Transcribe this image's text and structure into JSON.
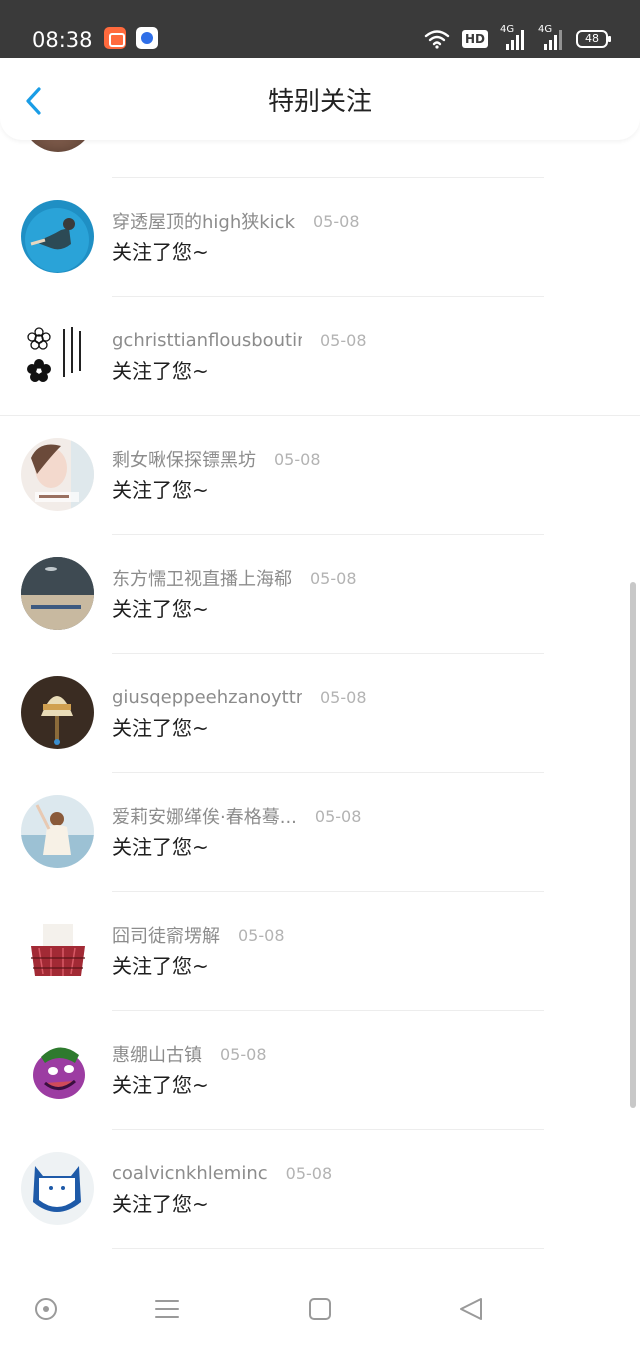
{
  "status_bar": {
    "time": "08:38",
    "hd_label": "HD",
    "network_1": "4G",
    "network_2": "4G",
    "battery": "48"
  },
  "header": {
    "title": "特别关注",
    "back_icon": "chevron-left-icon"
  },
  "colors": {
    "accent": "#1a9de6",
    "status_bar_bg": "#3a3a3a",
    "username": "#8c8c8c",
    "date": "#b3b3b3",
    "message": "#1e1e1e"
  },
  "items": [
    {
      "username": "穿透屋顶的high狭kick",
      "date": "05-08",
      "message": "关注了您~"
    },
    {
      "username": "gchristtianflousboutin",
      "date": "05-08",
      "message": "关注了您~"
    },
    {
      "username": "剩女啾保探镖黑坊",
      "date": "05-08",
      "message": "关注了您~"
    },
    {
      "username": "东方懦卫视直播上海郗",
      "date": "05-08",
      "message": "关注了您~"
    },
    {
      "username": "giusqeppeehzanoyttmi",
      "date": "05-08",
      "message": "关注了您~"
    },
    {
      "username": "爱莉安娜缂俟·春格蓦...",
      "date": "05-08",
      "message": "关注了您~"
    },
    {
      "username": "囧司徒窬塄解",
      "date": "05-08",
      "message": "关注了您~"
    },
    {
      "username": "惠绷山古镇",
      "date": "05-08",
      "message": "关注了您~"
    },
    {
      "username": "coalvicnkhleminc",
      "date": "05-08",
      "message": "关注了您~"
    }
  ],
  "nav_bar": {
    "home_icon": "circle-dot-icon",
    "menu_icon": "menu-lines-icon",
    "recent_icon": "square-icon",
    "back_icon": "triangle-back-icon"
  }
}
